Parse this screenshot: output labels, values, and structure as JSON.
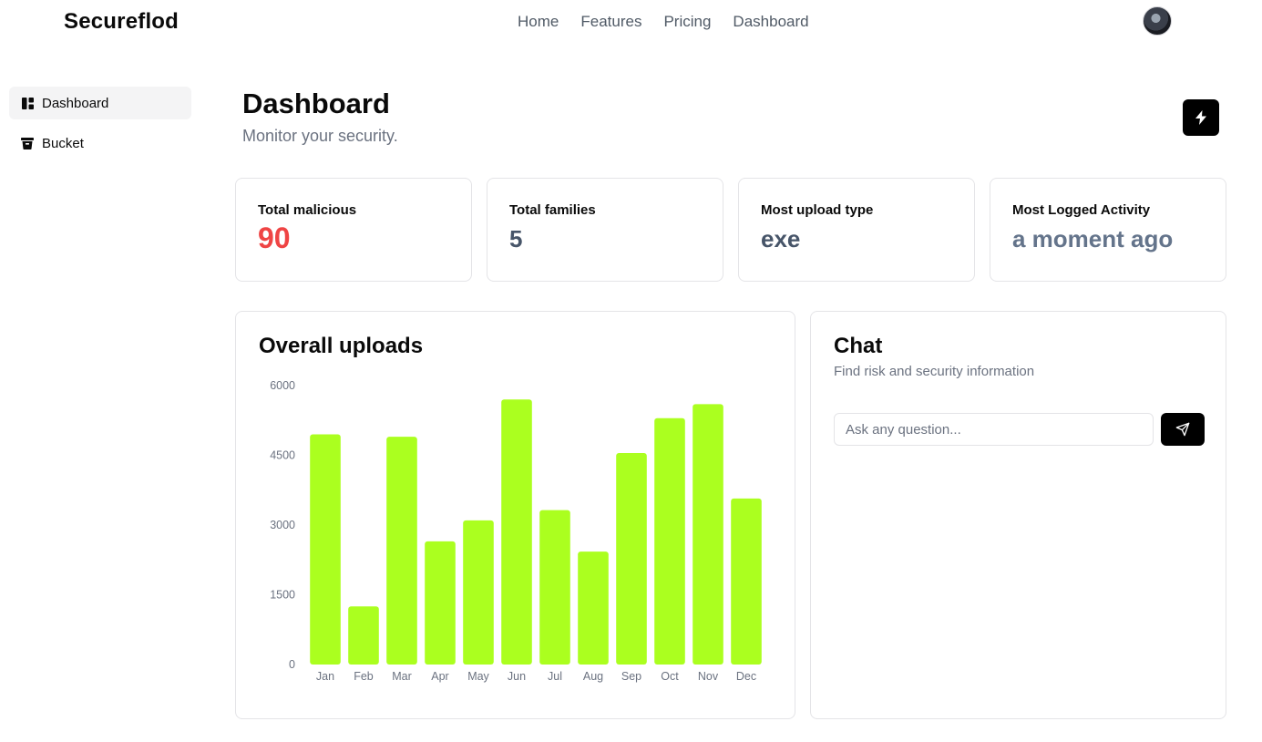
{
  "brand": "Secureflod",
  "nav": {
    "links": [
      "Home",
      "Features",
      "Pricing",
      "Dashboard"
    ]
  },
  "sidebar": {
    "items": [
      {
        "label": "Dashboard",
        "icon": "layout-dashboard-icon"
      },
      {
        "label": "Bucket",
        "icon": "bucket-icon"
      }
    ]
  },
  "header": {
    "title": "Dashboard",
    "subtitle": "Monitor your security."
  },
  "stats": [
    {
      "label": "Total malicious",
      "value": "90",
      "color": "#ef4444"
    },
    {
      "label": "Total families",
      "value": "5",
      "color": "#475569"
    },
    {
      "label": "Most upload type",
      "value": "exe",
      "color": "#475569"
    },
    {
      "label": "Most Logged Activity",
      "value": "a moment ago",
      "color": "#64748b"
    }
  ],
  "chart_card": {
    "title": "Overall uploads"
  },
  "chart_data": {
    "type": "bar",
    "categories": [
      "Jan",
      "Feb",
      "Mar",
      "Apr",
      "May",
      "Jun",
      "Jul",
      "Aug",
      "Sep",
      "Oct",
      "Nov",
      "Dec"
    ],
    "values": [
      4950,
      1250,
      4900,
      2650,
      3100,
      5700,
      3320,
      2430,
      4550,
      5300,
      5600,
      3570
    ],
    "yticks": [
      0,
      1500,
      3000,
      4500,
      6000
    ],
    "ylim": [
      0,
      6000
    ],
    "bar_color": "#abff1f",
    "grid": false
  },
  "chat": {
    "title": "Chat",
    "subtitle": "Find risk and security information",
    "placeholder": "Ask any question..."
  }
}
